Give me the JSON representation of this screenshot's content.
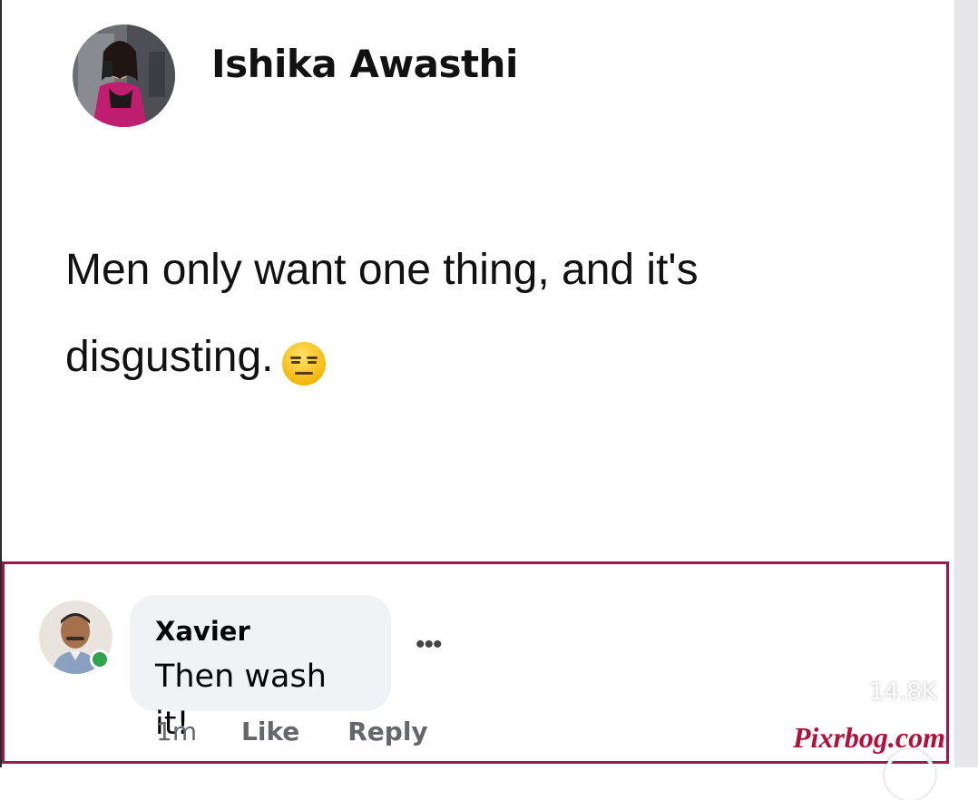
{
  "post": {
    "author": "Ishika Awasthi",
    "text_line1": "Men only want one thing, and it's",
    "text_line2": "disgusting.",
    "emoji": "expressionless-face"
  },
  "comment": {
    "name": "Xavier",
    "text": "Then wash it!",
    "time": "1m",
    "like_label": "Like",
    "reply_label": "Reply",
    "more_label": "•••",
    "online": true
  },
  "overlay": {
    "like_count": "14.8K",
    "watermark": "Pixrbog.com"
  },
  "colors": {
    "highlight_border": "#a2184b",
    "online_status": "#31a24c",
    "bubble_bg": "#f0f2f5",
    "watermark": "#b0103a"
  }
}
